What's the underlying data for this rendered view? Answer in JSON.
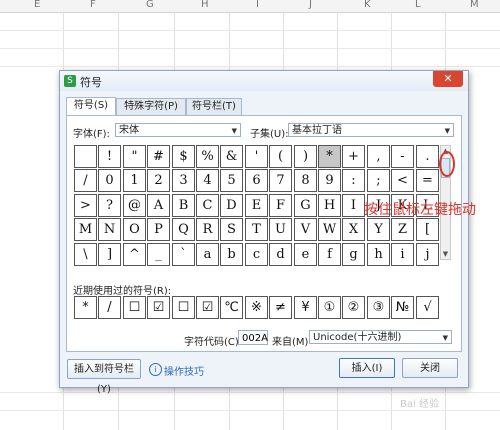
{
  "sheet": {
    "columns": [
      "E",
      "F",
      "G",
      "H",
      "I",
      "J",
      "K",
      "L",
      "M"
    ]
  },
  "dialog": {
    "title": "符号",
    "tabs": [
      "符号(S)",
      "特殊字符(P)",
      "符号栏(T)"
    ],
    "font_label": "字体(F):",
    "font_value": "宋体",
    "subset_label": "子集(U):",
    "subset_value": "基本拉丁语",
    "symbols": [
      [
        "",
        "!",
        "\"",
        "#",
        "$",
        "%",
        "&",
        "'",
        "(",
        ")",
        "*",
        "+",
        ",",
        "-",
        "."
      ],
      [
        "/",
        "0",
        "1",
        "2",
        "3",
        "4",
        "5",
        "6",
        "7",
        "8",
        "9",
        ":",
        ";",
        "<",
        "="
      ],
      [
        ">",
        "?",
        "@",
        "A",
        "B",
        "C",
        "D",
        "E",
        "F",
        "G",
        "H",
        "I",
        "J",
        "K",
        "L"
      ],
      [
        "M",
        "N",
        "O",
        "P",
        "Q",
        "R",
        "S",
        "T",
        "U",
        "V",
        "W",
        "X",
        "Y",
        "Z",
        "["
      ],
      [
        "\\",
        "]",
        "^",
        "_",
        "`",
        "a",
        "b",
        "c",
        "d",
        "e",
        "f",
        "g",
        "h",
        "i",
        "j"
      ]
    ],
    "selected_symbol": "*",
    "recent_label": "近期使用过的符号(R):",
    "recent_symbols": [
      "*",
      "/",
      "☐",
      "☑",
      "☐",
      "☑",
      "℃",
      "※",
      "≠",
      "¥",
      "①",
      "②",
      "③",
      "№",
      "√"
    ],
    "charcode_label": "字符代码(C):",
    "charcode_value": "002A",
    "from_label": "来自(M)",
    "from_value": "Unicode(十六进制)",
    "insert_to_bar_button": "插入到符号栏(Y)",
    "tips_link": "操作技巧",
    "insert_button": "插入(I)",
    "close_button": "关闭"
  },
  "annotation": {
    "text": "按住鼠标左键拖动",
    "color": "#e0322a"
  },
  "watermark": "Bai 经验"
}
